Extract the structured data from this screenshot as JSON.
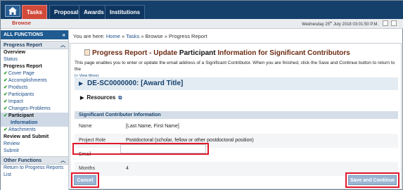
{
  "nav": {
    "home_icon": "home-icon",
    "tabs": [
      {
        "label": "Tasks",
        "active": true
      },
      {
        "label": "Proposals",
        "active": false
      },
      {
        "label": "Awards",
        "active": false
      },
      {
        "label": "Institutions",
        "active": false
      }
    ]
  },
  "subbar": {
    "browse": "Browse",
    "date_prefix": "Wednesday 25",
    "date_sup": "th",
    "date_rest": " July 2018 03:01:50 P.M."
  },
  "sidebar": {
    "header": "ALL FUNCTIONS",
    "progress_report": {
      "title": "Progress Report",
      "items": [
        {
          "label": "Overview",
          "style": "bold"
        },
        {
          "label": "Status",
          "style": "link"
        },
        {
          "label": "Progress Report",
          "style": "bold"
        },
        {
          "label": "Cover Page",
          "style": "check"
        },
        {
          "label": "Accomplishments",
          "style": "check"
        },
        {
          "label": "Products",
          "style": "check"
        },
        {
          "label": "Participants",
          "style": "check"
        },
        {
          "label": "Impact",
          "style": "check"
        },
        {
          "label": "Changes-Problems",
          "style": "check"
        },
        {
          "label": "Participant",
          "style": "selected"
        },
        {
          "label": "Information",
          "style": "subselected"
        },
        {
          "label": "Attachments",
          "style": "check"
        },
        {
          "label": "Review and Submit",
          "style": "bold"
        },
        {
          "label": "Review",
          "style": "link"
        },
        {
          "label": "Submit",
          "style": "link"
        }
      ]
    },
    "other_functions": {
      "title": "Other Functions",
      "items": [
        {
          "label": "Return to Progress Reports"
        },
        {
          "label": "List"
        }
      ]
    }
  },
  "breadcrumb": {
    "prefix": "You are here:",
    "home": "Home",
    "tasks": "Tasks",
    "browse": "Browse",
    "current": "Progress Report"
  },
  "main": {
    "title_a": "Progress Report - Update ",
    "title_b": "Participant",
    "title_c": " Information for Significant Contributors",
    "desc": "This page enables you to enter or update the email address of a Significant Contributor. When you are finished, click the Save and Continue button to return to the",
    "view_more": "(+ View More)",
    "award": "DE-SC0000000: [Award Title]",
    "resources": "Resources",
    "section_header": "Significant Contributor Information",
    "fields": [
      {
        "label": "Name",
        "value": "[Last Name, First Name]"
      },
      {
        "label": "Project Role",
        "value": "Postdoctoral (scholar, fellow or other postdoctoral position)"
      },
      {
        "label": "Email",
        "value": ""
      },
      {
        "label": "Months",
        "value": "4"
      }
    ],
    "cancel": "Cancel",
    "save": "Save and Continue"
  },
  "colors": {
    "nav_bg": "#15406b",
    "active_tab": "#d24a3a",
    "title": "#6b2a12",
    "highlight": "#e0182b"
  }
}
